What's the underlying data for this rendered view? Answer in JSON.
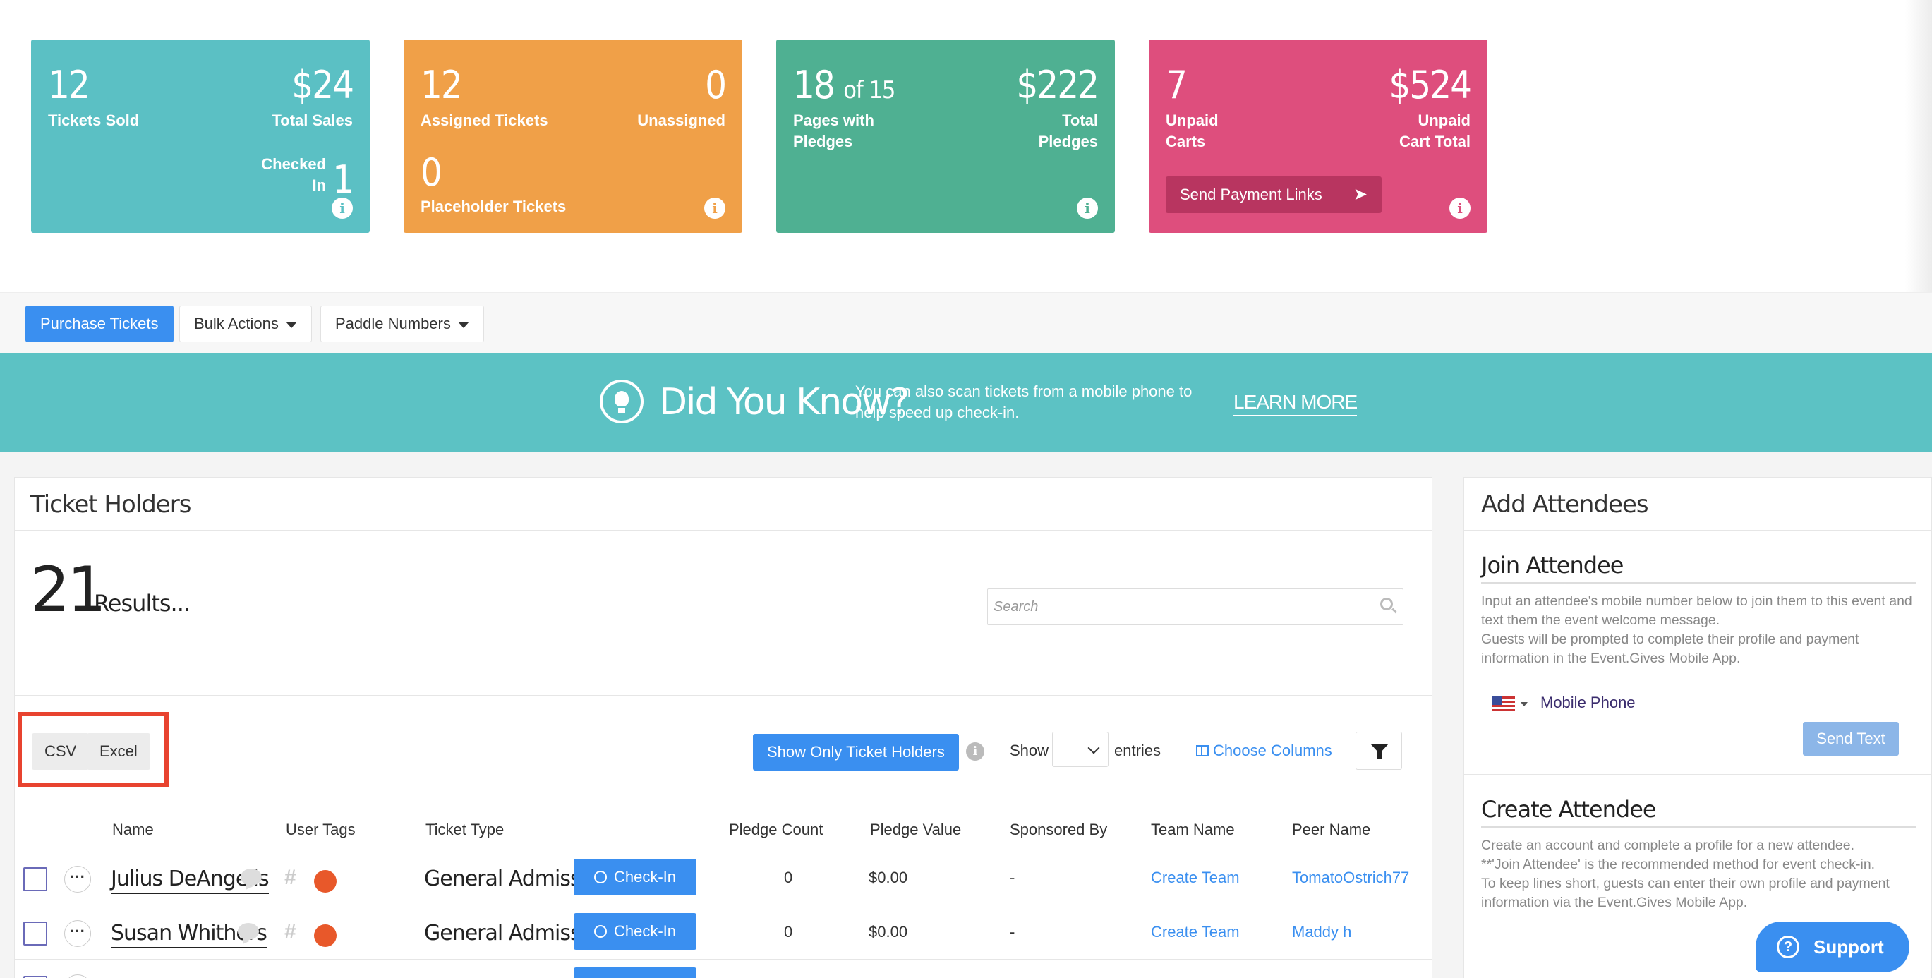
{
  "cards": {
    "tickets": {
      "sold_num": "12",
      "sold_label": "Tickets Sold",
      "sales_num": "$24",
      "sales_label": "Total Sales",
      "checked_label_1": "Checked",
      "checked_label_2": "In",
      "checked_num": "1",
      "color": "#5bc0c4"
    },
    "assigned": {
      "assigned_num": "12",
      "assigned_label": "Assigned Tickets",
      "unassigned_num": "0",
      "unassigned_label": "Unassigned",
      "placeholder_num": "0",
      "placeholder_label": "Placeholder Tickets",
      "color": "#f0a048"
    },
    "pledges": {
      "pages_num": "18",
      "pages_of": "of 15",
      "pages_label_1": "Pages with",
      "pages_label_2": "Pledges",
      "total_num": "$222",
      "total_label_1": "Total",
      "total_label_2": "Pledges",
      "color": "#4fb092"
    },
    "carts": {
      "unpaid_num": "7",
      "unpaid_label_1": "Unpaid",
      "unpaid_label_2": "Carts",
      "total_num": "$524",
      "total_label_1": "Unpaid",
      "total_label_2": "Cart Total",
      "send_label": "Send Payment Links",
      "color": "#de4e7d"
    },
    "info_glyph": "i"
  },
  "toolbar": {
    "purchase": "Purchase Tickets",
    "bulk": "Bulk Actions",
    "paddle": "Paddle Numbers"
  },
  "banner": {
    "title": "Did You Know?",
    "text": "You can also scan tickets from a mobile phone to help speed up check-in.",
    "learn_more": "LEARN MORE"
  },
  "ticket_holders": {
    "title": "Ticket Holders",
    "results_count": "21",
    "results_label": "Results...",
    "search_placeholder": "Search",
    "csv": "CSV",
    "excel": "Excel",
    "show_only": "Show Only Ticket Holders",
    "show": "Show",
    "entries": "entries",
    "choose_columns": "Choose Columns",
    "columns": [
      "Name",
      "User Tags",
      "Ticket Type",
      "Pledge Count",
      "Pledge Value",
      "Sponsored By",
      "Team Name",
      "Peer Name"
    ],
    "checkin_label": "Check-In",
    "rows": [
      {
        "name": "Julius DeAngelis",
        "ticket_type": "General Admission",
        "pledge_count": "0",
        "pledge_value": "$0.00",
        "sponsored_by": "-",
        "team_name": "Create Team",
        "peer_name": "TomatoOstrich77"
      },
      {
        "name": "Susan Whithers",
        "ticket_type": "General Admission",
        "pledge_count": "0",
        "pledge_value": "$0.00",
        "sponsored_by": "-",
        "team_name": "Create Team",
        "peer_name": "Maddy h"
      }
    ]
  },
  "add_attendees": {
    "title": "Add Attendees",
    "join_title": "Join Attendee",
    "join_text_1": "Input an attendee's mobile number below to join them to this event and text them the event welcome message.",
    "join_text_2": "Guests will be prompted to complete their profile and payment information in the Event.Gives Mobile App.",
    "phone_placeholder": "Mobile Phone",
    "send_text": "Send Text",
    "create_title": "Create Attendee",
    "create_text_1": "Create an account and complete a profile for a new attendee.",
    "create_text_2": "**'Join Attendee' is the recommended method for event check-in.",
    "create_text_3": "To keep lines short, guests can enter their own profile and payment information via the Event.Gives Mobile App."
  },
  "support": {
    "label": "Support"
  }
}
